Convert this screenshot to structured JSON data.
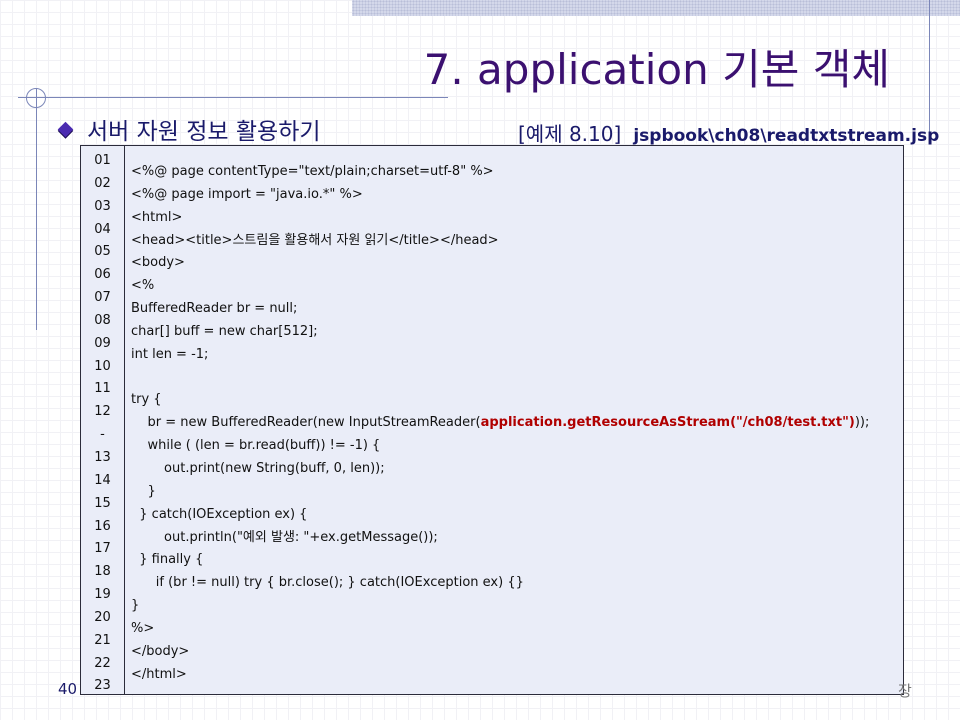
{
  "slide": {
    "title": "7. application 기본 객체",
    "bullet": "서버 자원 정보 활용하기",
    "example_label": "[예제 8.10]",
    "example_path": "jspbook\\ch08\\readtxtstream.jsp",
    "page_number": "40",
    "footer_char": "장"
  },
  "code": {
    "line_numbers": [
      "01",
      "02",
      "03",
      "04",
      "05",
      "06",
      "07",
      "08",
      "09",
      "10",
      "11",
      "12",
      "-",
      "13",
      "14",
      "15",
      "16",
      "17",
      "18",
      "19",
      "20",
      "21",
      "22",
      "23"
    ],
    "lines": [
      {
        "pre": "<%@ page contentType=\"text/plain;charset=utf-8\" %>",
        "hl": "",
        "post": ""
      },
      {
        "pre": "<%@ page import = \"java.io.*\" %>",
        "hl": "",
        "post": ""
      },
      {
        "pre": "<html>",
        "hl": "",
        "post": ""
      },
      {
        "pre": "<head><title>스트림을 활용해서 자원 읽기</title></head>",
        "hl": "",
        "post": ""
      },
      {
        "pre": "<body>",
        "hl": "",
        "post": ""
      },
      {
        "pre": "<%",
        "hl": "",
        "post": ""
      },
      {
        "pre": "BufferedReader br = null;",
        "hl": "",
        "post": ""
      },
      {
        "pre": "char[] buff = new char[512];",
        "hl": "",
        "post": ""
      },
      {
        "pre": "int len = -1;",
        "hl": "",
        "post": ""
      },
      {
        "pre": "",
        "hl": "",
        "post": ""
      },
      {
        "pre": "try {",
        "hl": "",
        "post": ""
      },
      {
        "pre": "    br = new BufferedReader(new InputStreamReader(",
        "hl": "application.getResourceAsStream(\"/ch08/test.txt\")",
        "post": "));"
      },
      {
        "pre": "    while ( (len = br.read(buff)) != -1) {",
        "hl": "",
        "post": ""
      },
      {
        "pre": "        out.print(new String(buff, 0, len));",
        "hl": "",
        "post": ""
      },
      {
        "pre": "    }",
        "hl": "",
        "post": ""
      },
      {
        "pre": "  } catch(IOException ex) {",
        "hl": "",
        "post": ""
      },
      {
        "pre": "        out.println(\"예외 발생: \"+ex.getMessage());",
        "hl": "",
        "post": ""
      },
      {
        "pre": "  } finally {",
        "hl": "",
        "post": ""
      },
      {
        "pre": "      if (br != null) try { br.close(); } catch(IOException ex) {}",
        "hl": "",
        "post": ""
      },
      {
        "pre": "}",
        "hl": "",
        "post": ""
      },
      {
        "pre": "%>",
        "hl": "",
        "post": ""
      },
      {
        "pre": "</body>",
        "hl": "",
        "post": ""
      },
      {
        "pre": "</html>",
        "hl": "",
        "post": ""
      }
    ]
  },
  "colors": {
    "title": "#3b1070",
    "highlight": "#b00000",
    "code_bg": "#eaedf8"
  }
}
